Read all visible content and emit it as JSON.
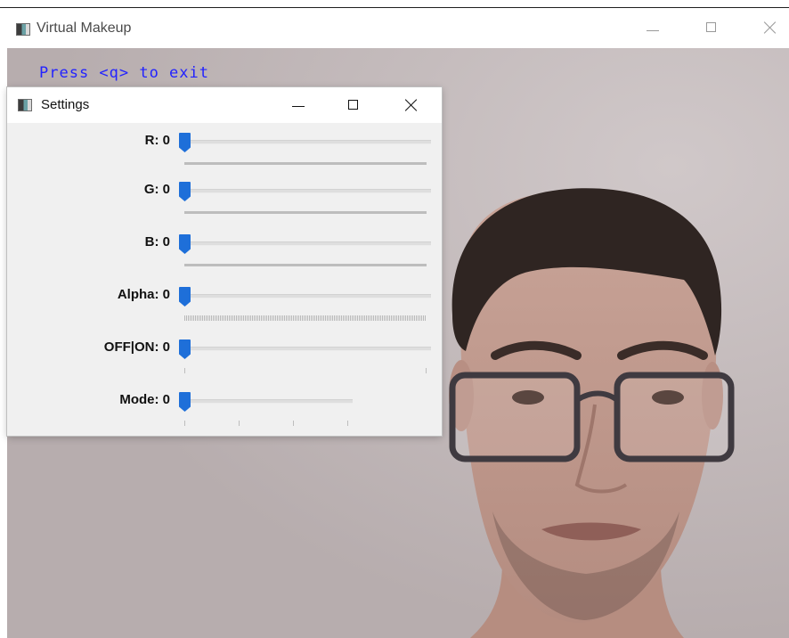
{
  "main_window": {
    "title": "Virtual Makeup",
    "icon": "app-window-icon"
  },
  "camera": {
    "overlay_text": "Press <q> to exit"
  },
  "settings": {
    "title": "Settings",
    "icon": "app-window-icon",
    "trackbars": [
      {
        "label": "R: 0",
        "value": 0
      },
      {
        "label": "G: 0",
        "value": 0
      },
      {
        "label": "B: 0",
        "value": 0
      },
      {
        "label": "Alpha: 0",
        "value": 0
      },
      {
        "label": "OFF|ON: 0",
        "value": 0
      },
      {
        "label": "Mode: 0",
        "value": 0
      }
    ]
  },
  "colors": {
    "overlay_text": "#2222ff",
    "slider_thumb": "#1e6fd9",
    "panel_bg": "#f0f0f0"
  }
}
